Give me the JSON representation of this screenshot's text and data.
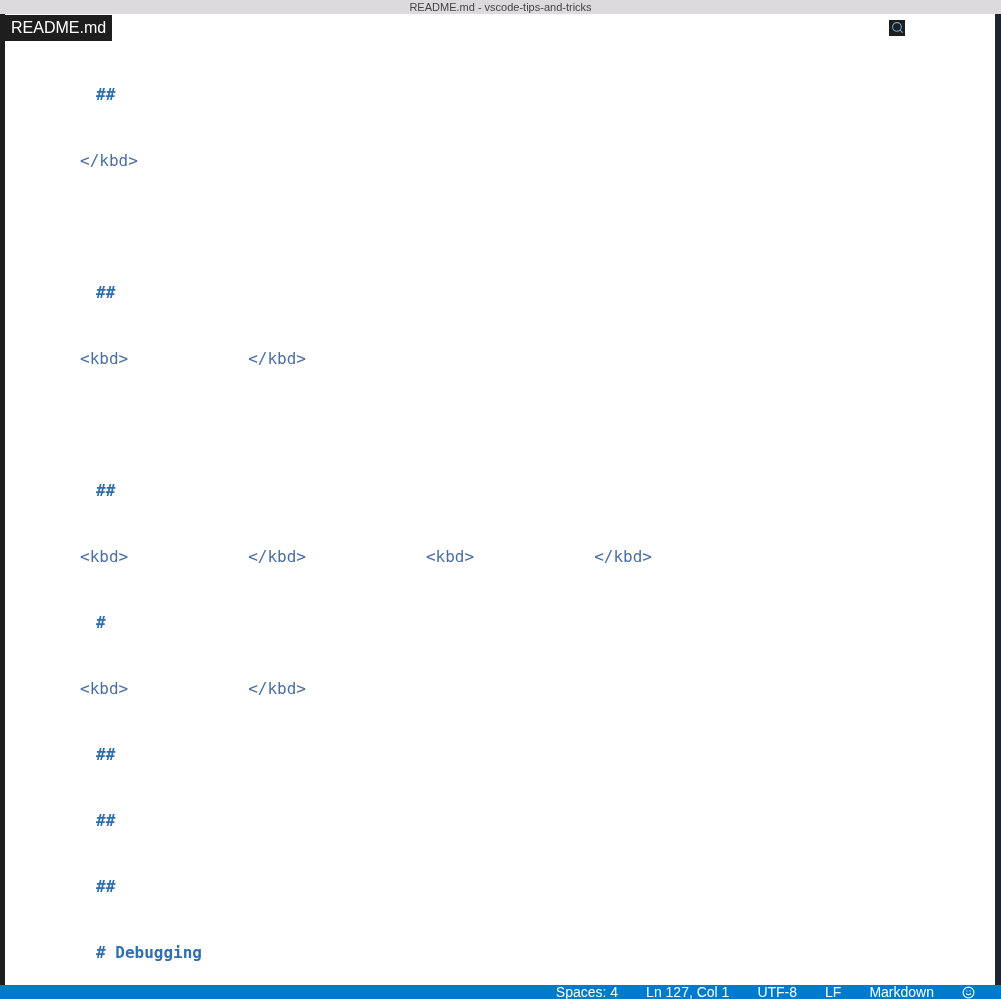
{
  "window": {
    "title": "README.md - vscode-tips-and-tricks"
  },
  "tabs": [
    {
      "label": "README.md",
      "selected": true
    }
  ],
  "editor": {
    "lines": [
      {
        "kind": "heading",
        "segments": [
          "##"
        ]
      },
      {
        "kind": "text",
        "segments": [
          "</kbd>"
        ]
      },
      {
        "kind": "blank"
      },
      {
        "kind": "heading",
        "segments": [
          "##"
        ]
      },
      {
        "kind": "text",
        "segments": [
          "<kbd>",
          "</kbd>"
        ]
      },
      {
        "kind": "blank"
      },
      {
        "kind": "heading",
        "segments": [
          "##"
        ]
      },
      {
        "kind": "text",
        "segments": [
          "<kbd>",
          "</kbd>",
          "<kbd>",
          "</kbd>"
        ]
      },
      {
        "kind": "heading",
        "segments": [
          "#"
        ]
      },
      {
        "kind": "text",
        "segments": [
          "<kbd>",
          "</kbd>"
        ]
      },
      {
        "kind": "heading",
        "segments": [
          "##"
        ]
      },
      {
        "kind": "heading",
        "segments": [
          "##"
        ]
      },
      {
        "kind": "heading",
        "segments": [
          "##"
        ]
      },
      {
        "kind": "heading",
        "segments": [
          "# Debugging"
        ]
      }
    ]
  },
  "status_bar": {
    "items": [
      "Spaces: 4",
      "Ln 127, Col 1",
      "UTF-8",
      "LF",
      "Markdown"
    ]
  }
}
